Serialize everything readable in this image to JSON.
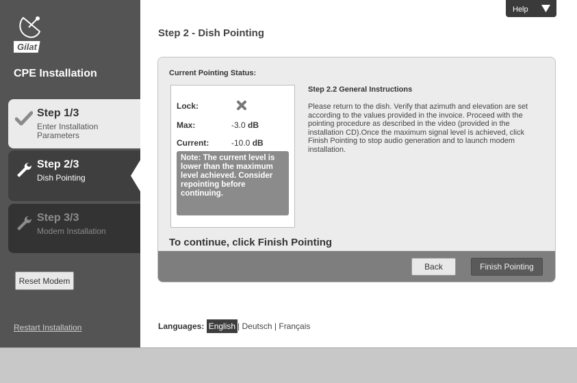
{
  "sidebar": {
    "brand": "Gilat",
    "title": "CPE Installation",
    "steps": [
      {
        "title": "Step 1/3",
        "subtitle": "Enter Installation Parameters",
        "icon": "checkmark-icon",
        "state": "completed"
      },
      {
        "title": "Step 2/3",
        "subtitle": "Dish Pointing",
        "icon": "wrench-icon",
        "state": "active"
      },
      {
        "title": "Step 3/3",
        "subtitle": "Modem Installation",
        "icon": "wrench-icon",
        "state": "pending"
      }
    ],
    "reset_label": "Reset Modem",
    "restart_label": "Restart Installation"
  },
  "header": {
    "help_label": "Help",
    "step_heading": "Step 2 - Dish Pointing"
  },
  "status": {
    "label": "Current Pointing Status:",
    "lock_label": "Lock:",
    "lock_icon": "x-mark-icon",
    "max_label": "Max:",
    "max_value": "-3.0",
    "max_unit": "dB",
    "current_label": "Current:",
    "current_value": "-10.0",
    "current_unit": "dB",
    "note": "Note: The current level is lower than the maximum level achieved. Consider repointing before continuing."
  },
  "instructions": {
    "heading": "Step 2.2 General Instructions",
    "body": "Please return to the dish. Verify that azimuth and elevation are set according to the values provided in the invoice. Proceed with the pointing procedure as described in the video (provided in the installation CD).Once the maximum signal level is achieved, click Finish Pointing to stop audio generation and to launch modem installation."
  },
  "continue_text": "To continue, click Finish Pointing",
  "buttons": {
    "back": "Back",
    "finish": "Finish Pointing"
  },
  "languages": {
    "label": "Languages:",
    "options": [
      "English",
      "Deutsch",
      "Français"
    ],
    "selected": "English",
    "separator": "|"
  },
  "colors": {
    "sidebar": "#545454",
    "active_step": "#3f3f3f",
    "panel": "#ececec",
    "panel_footer": "#7e7e7e",
    "note": "#8b8b8b"
  }
}
